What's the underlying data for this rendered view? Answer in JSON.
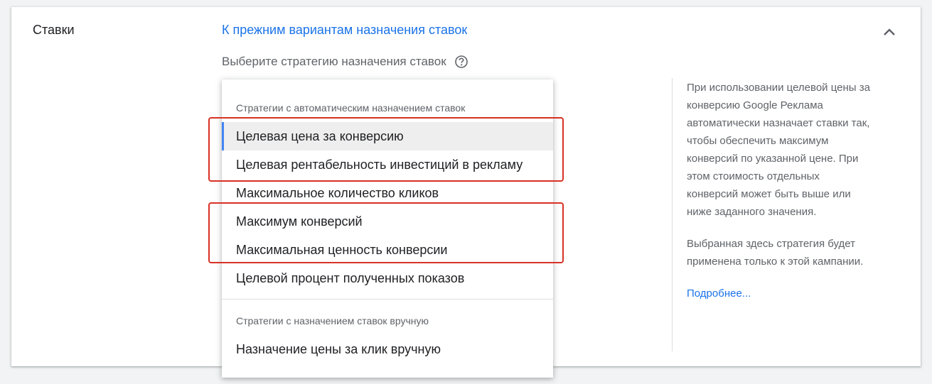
{
  "section": {
    "title": "Ставки",
    "old_link": "К прежним вариантам назначения ставок",
    "prompt": "Выберите стратегию назначения ставок"
  },
  "dropdown": {
    "auto_header": "Стратегии с автоматическим назначением ставок",
    "auto_options": [
      "Целевая цена за конверсию",
      "Целевая рентабельность инвестиций в рекламу",
      "Максимальное количество кликов",
      "Максимум конверсий",
      "Максимальная ценность конверсии",
      "Целевой процент полученных показов"
    ],
    "selected_option": "Целевая цена за конверсию",
    "manual_header": "Стратегии с назначением ставок вручную",
    "manual_options": [
      "Назначение цены за клик вручную"
    ]
  },
  "info": {
    "paragraph1": "При использовании целевой цены за конверсию Google Реклама автоматически назначает ставки так, чтобы обеспечить максимум конверсий по указанной цене. При этом стоимость отдельных конверсий может быть выше или ниже заданного значения.",
    "paragraph2": "Выбранная здесь стратегия будет применена только к этой кампании.",
    "learn_more": "Подробнее..."
  },
  "icons": {
    "collapse": "chevron-up-icon",
    "help": "help-circle-icon"
  },
  "colors": {
    "link": "#1a73e8",
    "selected_indicator": "#4285f4",
    "highlight_box": "#d93025"
  }
}
